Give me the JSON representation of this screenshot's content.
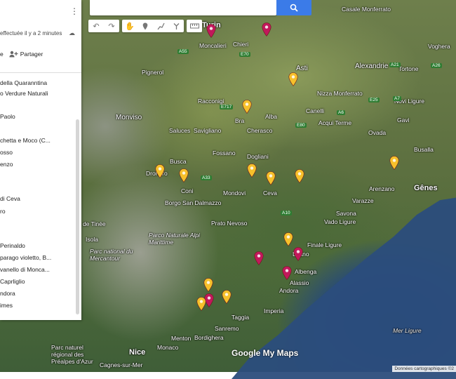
{
  "header": {
    "save_status": "effectuée il y a 2 minutes",
    "share_prefix": "e",
    "share_label": "Partager"
  },
  "panel": {
    "items": [
      {
        "label": "della Quaranntina"
      },
      {
        "label": "o Verdure Naturali"
      },
      {
        "label": "Paolo"
      },
      {
        "label": "chetta e Moco (C..."
      },
      {
        "label": "osso"
      },
      {
        "label": "enzo"
      },
      {
        "label": "di Ceva"
      },
      {
        "label": "ro"
      },
      {
        "label": "Perinaldo"
      },
      {
        "label": "parago violetto, B..."
      },
      {
        "label": "vanello di Monca..."
      },
      {
        "label": "Caprliglio"
      },
      {
        "label": "ndora"
      },
      {
        "label": "imes"
      }
    ]
  },
  "map": {
    "places": [
      {
        "name": "Turin"
      },
      {
        "name": "Moncalieri"
      },
      {
        "name": "Chieri"
      },
      {
        "name": "Casale Monferrato"
      },
      {
        "name": "Asti"
      },
      {
        "name": "Alexandrie"
      },
      {
        "name": "Tortone"
      },
      {
        "name": "Voghera"
      },
      {
        "name": "Pignerol"
      },
      {
        "name": "Racconigi"
      },
      {
        "name": "Bra"
      },
      {
        "name": "Alba"
      },
      {
        "name": "Nizza Monferrato"
      },
      {
        "name": "Canelli"
      },
      {
        "name": "Acqui Terme"
      },
      {
        "name": "Novi Ligure"
      },
      {
        "name": "Gavi"
      },
      {
        "name": "Ovada"
      },
      {
        "name": "Busalla"
      },
      {
        "name": "Monviso"
      },
      {
        "name": "Saluces"
      },
      {
        "name": "Savigliano"
      },
      {
        "name": "Cherasco"
      },
      {
        "name": "Busca"
      },
      {
        "name": "Fossano"
      },
      {
        "name": "Dogliani"
      },
      {
        "name": "Dronero"
      },
      {
        "name": "Coni"
      },
      {
        "name": "Mondovi"
      },
      {
        "name": "Ceva"
      },
      {
        "name": "Arenzano"
      },
      {
        "name": "Gênes"
      },
      {
        "name": "Borgo San Dalmazzo"
      },
      {
        "name": "Varazze"
      },
      {
        "name": "Savona"
      },
      {
        "name": "Vado Ligure"
      },
      {
        "name": "Prato Nevoso"
      },
      {
        "name": "de Tinée"
      },
      {
        "name": "Isola"
      },
      {
        "name": "Parco Naturale Alpi Marittime"
      },
      {
        "name": "Parc national du Mercantour"
      },
      {
        "name": "Finale Ligure"
      },
      {
        "name": "Loano"
      },
      {
        "name": "Albenga"
      },
      {
        "name": "Alassio"
      },
      {
        "name": "Andora"
      },
      {
        "name": "Imperia"
      },
      {
        "name": "Taggia"
      },
      {
        "name": "Sanremo"
      },
      {
        "name": "Menton"
      },
      {
        "name": "Bordighera"
      },
      {
        "name": "Nice"
      },
      {
        "name": "Monaco"
      },
      {
        "name": "Cagnes-sur-Mer"
      },
      {
        "name": "Parc naturel régional des Préalpes d'Azur"
      },
      {
        "name": "Mer Ligure"
      }
    ],
    "routes": [
      "A55",
      "E70",
      "E717",
      "A6",
      "A33",
      "E80",
      "E25",
      "A7",
      "A26",
      "A21",
      "A10"
    ],
    "pins": [
      {
        "color": "#c2185b"
      },
      {
        "color": "#c2185b"
      },
      {
        "color": "#f6c02b"
      },
      {
        "color": "#f6c02b"
      },
      {
        "color": "#f6c02b"
      },
      {
        "color": "#f6c02b"
      },
      {
        "color": "#f6c02b"
      },
      {
        "color": "#f6c02b"
      },
      {
        "color": "#f6c02b"
      },
      {
        "color": "#f6c02b"
      },
      {
        "color": "#f6c02b"
      },
      {
        "color": "#c2185b"
      },
      {
        "color": "#c2185b"
      },
      {
        "color": "#c2185b"
      },
      {
        "color": "#f6c02b"
      },
      {
        "color": "#c2185b"
      },
      {
        "color": "#f6c02b"
      },
      {
        "color": "#f6c02b"
      }
    ],
    "logo": "Google My Maps",
    "attribution": "Données cartographiques ©2"
  },
  "icons": {
    "search": "search-icon",
    "kebab": "more-vert-icon",
    "cloud": "cloud-saved-icon",
    "share": "person-add-icon",
    "undo": "undo-icon",
    "redo": "redo-icon",
    "pan": "hand-icon",
    "marker": "marker-icon",
    "line": "draw-line-icon",
    "directions": "directions-icon",
    "ruler": "ruler-icon"
  }
}
